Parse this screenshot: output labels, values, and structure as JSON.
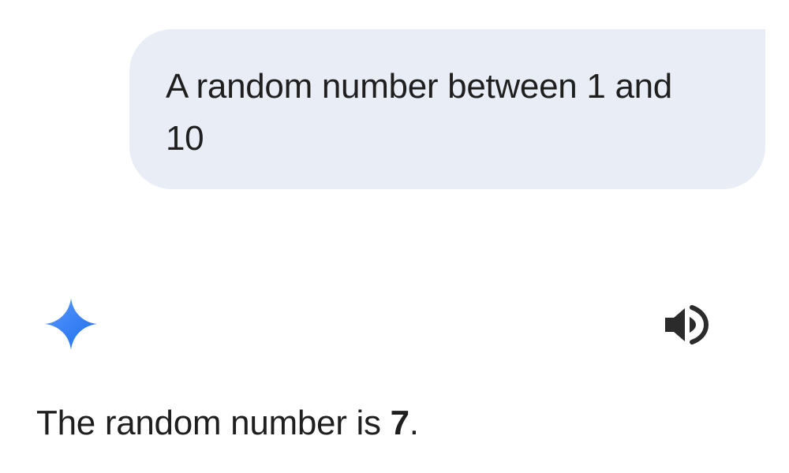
{
  "user_message": {
    "text": "A random number between 1 and 10"
  },
  "assistant": {
    "icon": "gemini-sparkle-icon",
    "speaker_icon": "speaker-icon",
    "response_prefix": "The random number is ",
    "response_value": "7",
    "response_suffix": "."
  },
  "colors": {
    "bubble_bg": "#e9eef6",
    "text": "#1f1f1f",
    "sparkle_start": "#4285f4",
    "sparkle_end": "#1a73e8"
  }
}
